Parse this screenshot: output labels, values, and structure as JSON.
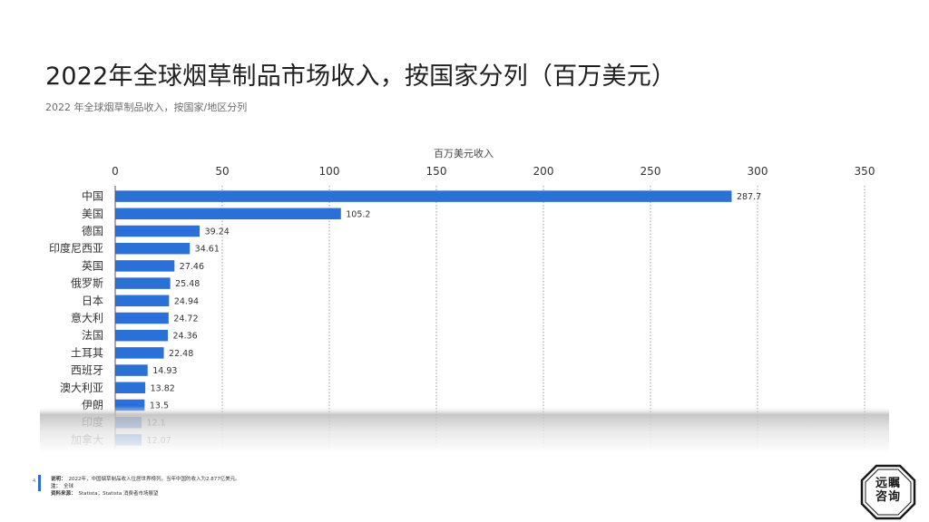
{
  "title": "2022年全球烟草制品市场收入，按国家分列（百万美元）",
  "subtitle": "2022 年全球烟草制品收入，按国家/地区分列",
  "chart_data": {
    "type": "bar",
    "orientation": "horizontal",
    "xlabel": "百万美元收入",
    "xlim": [
      0,
      350
    ],
    "xticks": [
      0,
      50,
      100,
      150,
      200,
      250,
      300,
      350
    ],
    "grid": true,
    "categories": [
      "中国",
      "美国",
      "德国",
      "印度尼西亚",
      "英国",
      "俄罗斯",
      "日本",
      "意大利",
      "法国",
      "土耳其",
      "西班牙",
      "澳大利亚",
      "伊朗",
      "印度",
      "加拿大"
    ],
    "values": [
      287.7,
      105.2,
      39.24,
      34.61,
      27.46,
      25.48,
      24.94,
      24.72,
      24.36,
      22.48,
      14.93,
      13.82,
      13.5,
      12.1,
      12.07
    ],
    "value_labels": [
      "287.7",
      "105.2",
      "39.24",
      "34.61",
      "27.46",
      "25.48",
      "24.94",
      "24.72",
      "24.36",
      "22.48",
      "14.93",
      "13.82",
      "13.5",
      "12.1",
      "12.07"
    ],
    "bar_color": "#2a70d6"
  },
  "footer": {
    "page": "4",
    "note_label": "说明：",
    "note_text": "2022年，中国烟草制品收入位居世界榜列。当年中国的收入为2.877亿美元。",
    "scope_label": "注：",
    "scope_text": "全球",
    "source_label": "资料来源：",
    "source_text": "Statista；Statista 消费者市场展望"
  },
  "logo": {
    "line1": "远瞩",
    "line2": "咨询",
    "icon": "company-logo-seal"
  }
}
